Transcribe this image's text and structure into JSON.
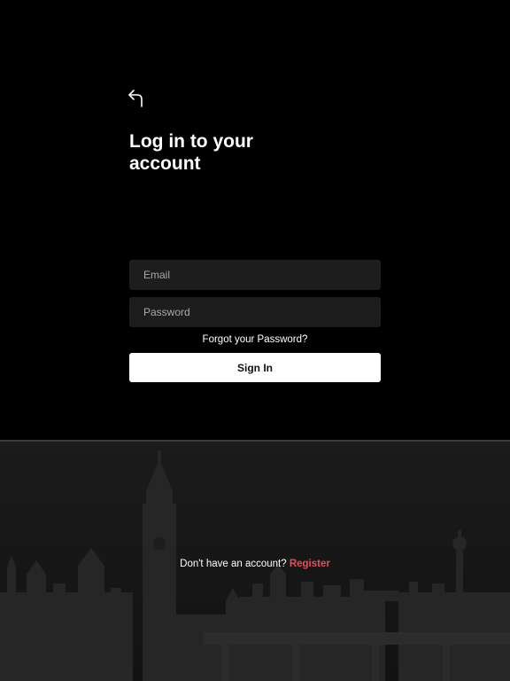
{
  "header": {
    "back_icon": "back-arrow-icon",
    "title": "Log in to your account"
  },
  "form": {
    "email_placeholder": "Email",
    "email_value": "",
    "password_placeholder": "Password",
    "password_value": "",
    "forgot_label": "Forgot your Password?",
    "signin_label": "Sign In"
  },
  "footer": {
    "prompt": "Don't have an account?",
    "register_label": "Register",
    "background_image": "london-skyline-image"
  },
  "colors": {
    "background": "#000000",
    "field_background": "#1d1d1d",
    "button_background": "#ffffff",
    "accent": "#e0505a"
  }
}
